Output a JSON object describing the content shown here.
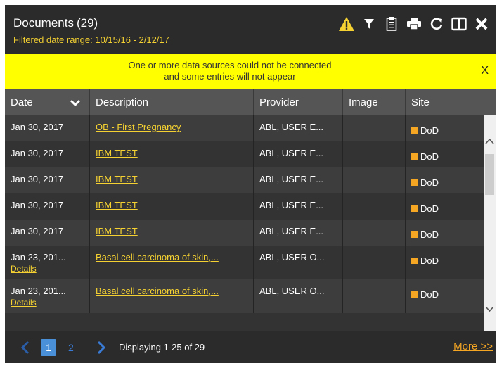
{
  "header": {
    "title": "Documents",
    "count": "(29)",
    "filter_text": "Filtered date range: 10/15/16 - 2/12/17"
  },
  "toolbar": {
    "icons": [
      "warning-icon",
      "filter-icon",
      "clipboard-icon",
      "print-icon",
      "refresh-icon",
      "split-view-icon",
      "close-icon"
    ],
    "warning_color": "#f5d232"
  },
  "banner": {
    "line1": "One or more data sources could not be connected",
    "line2": "and some entries will not appear",
    "close_label": "X",
    "bg_color": "#ffff00"
  },
  "table": {
    "columns": [
      "Date",
      "Description",
      "Provider",
      "Image",
      "Site"
    ],
    "rows": [
      {
        "date": "Jan 30, 2017",
        "description": "OB - First Pregnancy",
        "provider": "ABL, USER E...",
        "image": "",
        "site": "DoD",
        "details": ""
      },
      {
        "date": "Jan 30, 2017",
        "description": "IBM TEST",
        "provider": "ABL, USER E...",
        "image": "",
        "site": "DoD",
        "details": ""
      },
      {
        "date": "Jan 30, 2017",
        "description": "IBM TEST",
        "provider": "ABL, USER E...",
        "image": "",
        "site": "DoD",
        "details": ""
      },
      {
        "date": "Jan 30, 2017",
        "description": "IBM TEST",
        "provider": "ABL, USER E...",
        "image": "",
        "site": "DoD",
        "details": ""
      },
      {
        "date": "Jan 30, 2017",
        "description": "IBM TEST",
        "provider": "ABL, USER E...",
        "image": "",
        "site": "DoD",
        "details": ""
      },
      {
        "date": "Jan 23, 201...",
        "description": "Basal cell carcinoma of skin,...",
        "provider": "ABL, USER O...",
        "image": "",
        "site": "DoD",
        "details": "Details"
      },
      {
        "date": "Jan 23, 201...",
        "description": "Basal cell carcinoma of skin,...",
        "provider": "ABL, USER O...",
        "image": "",
        "site": "DoD",
        "details": "Details"
      }
    ],
    "site_color": "#f5a623"
  },
  "footer": {
    "pages": [
      "1",
      "2"
    ],
    "active_page": "1",
    "displaying": "Displaying 1-25 of 29",
    "more_label": "More >>"
  }
}
